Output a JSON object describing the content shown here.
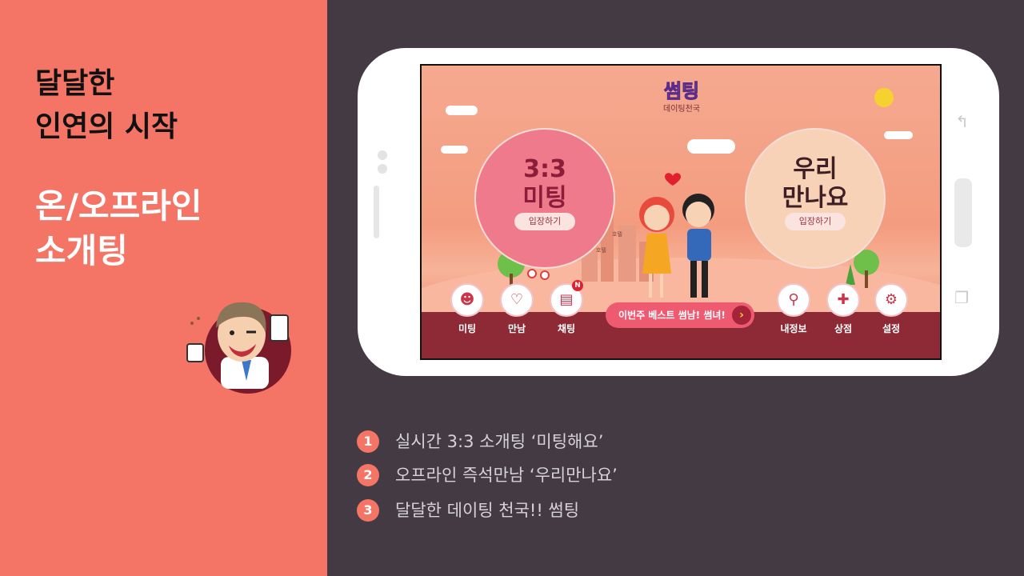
{
  "left_panel": {
    "headline_lines": [
      "달달한",
      "인연의 시작"
    ],
    "subheadline_lines": [
      "온/오프라인",
      "소개팅"
    ]
  },
  "app": {
    "logo": "썸팅",
    "logo_subtitle": "데이팅천국",
    "meeting": {
      "title_line1": "3:3",
      "title_line2": "미팅",
      "enter_label": "입장하기"
    },
    "meetup": {
      "title_line1": "우리",
      "title_line2": "만나요",
      "enter_label": "입장하기"
    },
    "city_signs": [
      "호텔",
      "호텔"
    ],
    "menu_left": [
      {
        "label": "미팅",
        "icon": "group-icon"
      },
      {
        "label": "만남",
        "icon": "heart-icon"
      },
      {
        "label": "채팅",
        "icon": "chat-icon",
        "badge": "N"
      }
    ],
    "best_button": "이번주 베스트 썸남! 썸녀!",
    "menu_right": [
      {
        "label": "내정보",
        "icon": "profile-icon"
      },
      {
        "label": "상점",
        "icon": "gift-icon"
      },
      {
        "label": "설정",
        "icon": "gear-icon"
      }
    ]
  },
  "features": [
    {
      "num": "1",
      "text": "실시간 3:3 소개팅 ‘미팅해요’"
    },
    {
      "num": "2",
      "text": "오프라인 즉석만남 ‘우리만나요’"
    },
    {
      "num": "3",
      "text": "달달한 데이팅 천국!! 썸팅"
    }
  ],
  "colors": {
    "accent": "#f47565",
    "background": "#433a44",
    "app_bar": "#8d2a35"
  }
}
